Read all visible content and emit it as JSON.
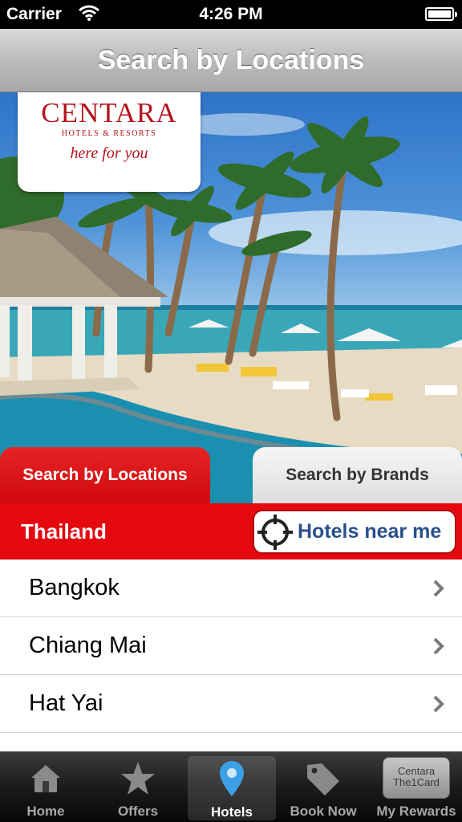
{
  "status_bar": {
    "carrier": "Carrier",
    "time": "4:26 PM"
  },
  "nav": {
    "title": "Search by Locations"
  },
  "logo": {
    "name": "CENTARA",
    "subtitle": "HOTELS & RESORTS",
    "tagline": "here for you"
  },
  "tabs": [
    {
      "label": "Search by Locations",
      "selected": true
    },
    {
      "label": "Search by Brands",
      "selected": false
    }
  ],
  "country": {
    "name": "Thailand",
    "near_me_label": "Hotels near me"
  },
  "cities": [
    {
      "label": "Bangkok"
    },
    {
      "label": "Chiang Mai"
    },
    {
      "label": "Hat Yai"
    }
  ],
  "tab_bar": {
    "items": [
      {
        "label": "Home",
        "icon": "home-icon"
      },
      {
        "label": "Offers",
        "icon": "star-icon"
      },
      {
        "label": "Hotels",
        "icon": "location-pin-icon",
        "selected": true
      },
      {
        "label": "Book Now",
        "icon": "tag-icon"
      },
      {
        "label": "My Rewards",
        "icon": "the1card-icon",
        "card_text": "Centara The1Card"
      }
    ]
  },
  "colors": {
    "brand_red": "#e3090f",
    "link_blue": "#2a4f8a",
    "pin_blue": "#3ba0e6"
  }
}
